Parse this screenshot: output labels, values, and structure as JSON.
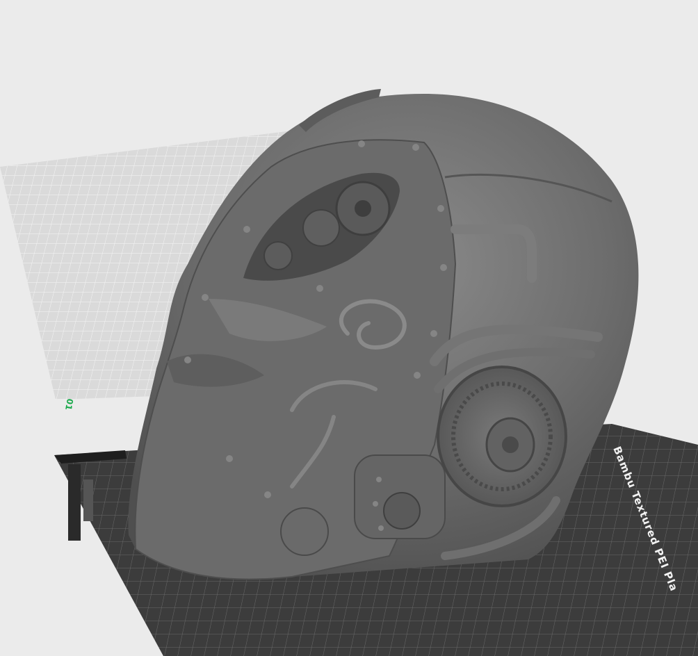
{
  "scene": {
    "plate_label": "Bambu Textured PEI Pla",
    "plate_number": "01",
    "model": "steampunk-helmet"
  },
  "colors": {
    "background": "#ebebeb",
    "grid_light": "#d9d9d9",
    "grid_line": "#f7f7f7",
    "plate_dark": "#3f3f3f",
    "model_gray": "#6d6d6d",
    "plate_number_green": "#19a84a"
  }
}
